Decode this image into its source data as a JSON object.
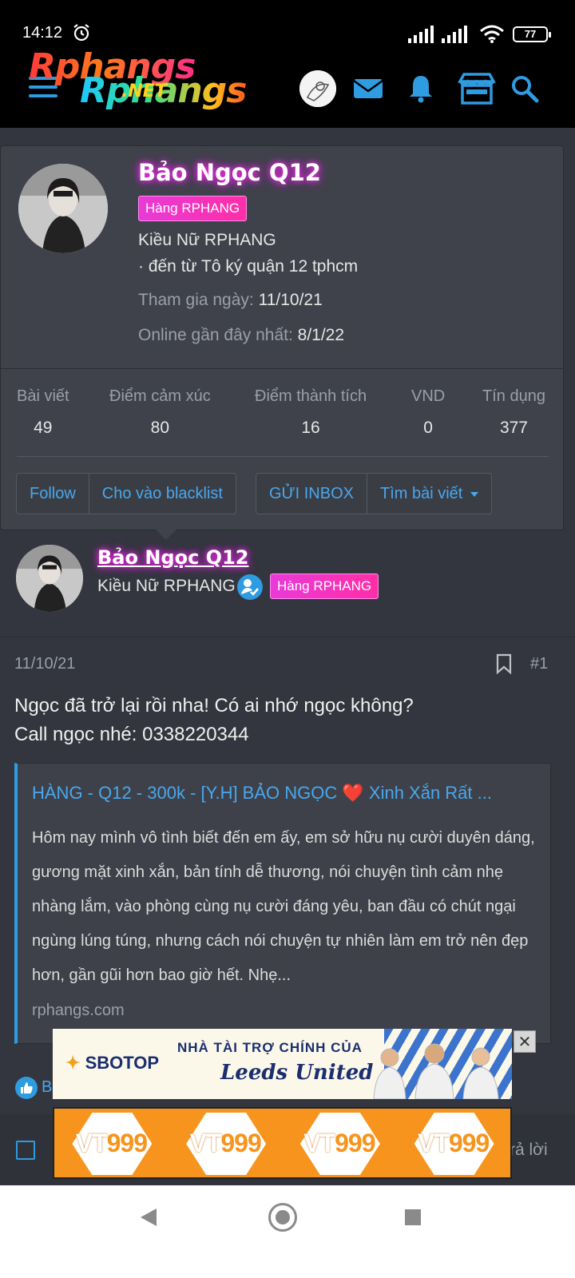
{
  "status_bar": {
    "time": "14:12",
    "battery": "77"
  },
  "header": {
    "logo_text_top": "Rphangs",
    "logo_text_bottom": "Rphangs",
    "logo_net": ".NET"
  },
  "profile": {
    "name": "Bảo Ngọc Q12",
    "badge": "Hàng RPHANG",
    "title": "Kiều Nữ RPHANG",
    "location": "· đến từ Tô ký quận 12 tphcm",
    "joined_label": "Tham gia ngày:",
    "joined_value": "11/10/21",
    "last_seen_label": "Online gần đây nhất:",
    "last_seen_value": "8/1/22",
    "stats": [
      {
        "label": "Bài viết",
        "value": "49"
      },
      {
        "label": "Điểm cảm xúc",
        "value": "80"
      },
      {
        "label": "Điểm thành tích",
        "value": "16"
      },
      {
        "label": "VND",
        "value": "0"
      },
      {
        "label": "Tín dụng",
        "value": "377"
      }
    ],
    "actions": {
      "follow": "Follow",
      "blacklist": "Cho vào blacklist",
      "inbox": "GỬI INBOX",
      "find_posts": "Tìm bài viết"
    }
  },
  "post": {
    "author": "Bảo Ngọc Q12",
    "author_title": "Kiều Nữ RPHANG",
    "author_badge": "Hàng RPHANG",
    "date": "11/10/21",
    "number": "#1",
    "text_line1": "Ngọc đã trở lại rồi nha! Có ai nhớ ngọc không?",
    "text_line2": "Call ngọc nhé: 0338220344",
    "preview": {
      "title_before_heart": "HÀNG - Q12 - 300k - [Y.H] BẢO NGỌC",
      "heart": "❤️",
      "title_after_heart": " Xinh Xắn Rất ...",
      "body": "Hôm nay mình vô tình biết đến em ấy, em sở hữu nụ cười duyên dáng, gương mặt xinh xắn, bản tính dễ thương, nói chuyện tình cảm nhẹ nhàng lắm, vào phòng cùng nụ cười đáng yêu, ban đầu có chút ngại ngùng lúng túng, nhưng cách nói chuyện tự nhiên làm em trở nên đẹp hơn, gần gũi hơn bao giờ hết. Nhẹ...",
      "domain": "rphangs.com"
    },
    "reaction_text": "B",
    "reply_text": "rả lời"
  },
  "ads": {
    "sbotop_logo": "SBOTOP",
    "sbotop_line1": "NHÀ TÀI TRỢ CHÍNH CỦA",
    "sbotop_line2": "Leeds United",
    "close": "✕",
    "vt_brand_prefix": "VT",
    "vt_brand_suffix": "999"
  },
  "colors": {
    "accent": "#2f9be0",
    "badge": "#ff2ea6",
    "background": "#33363e"
  }
}
